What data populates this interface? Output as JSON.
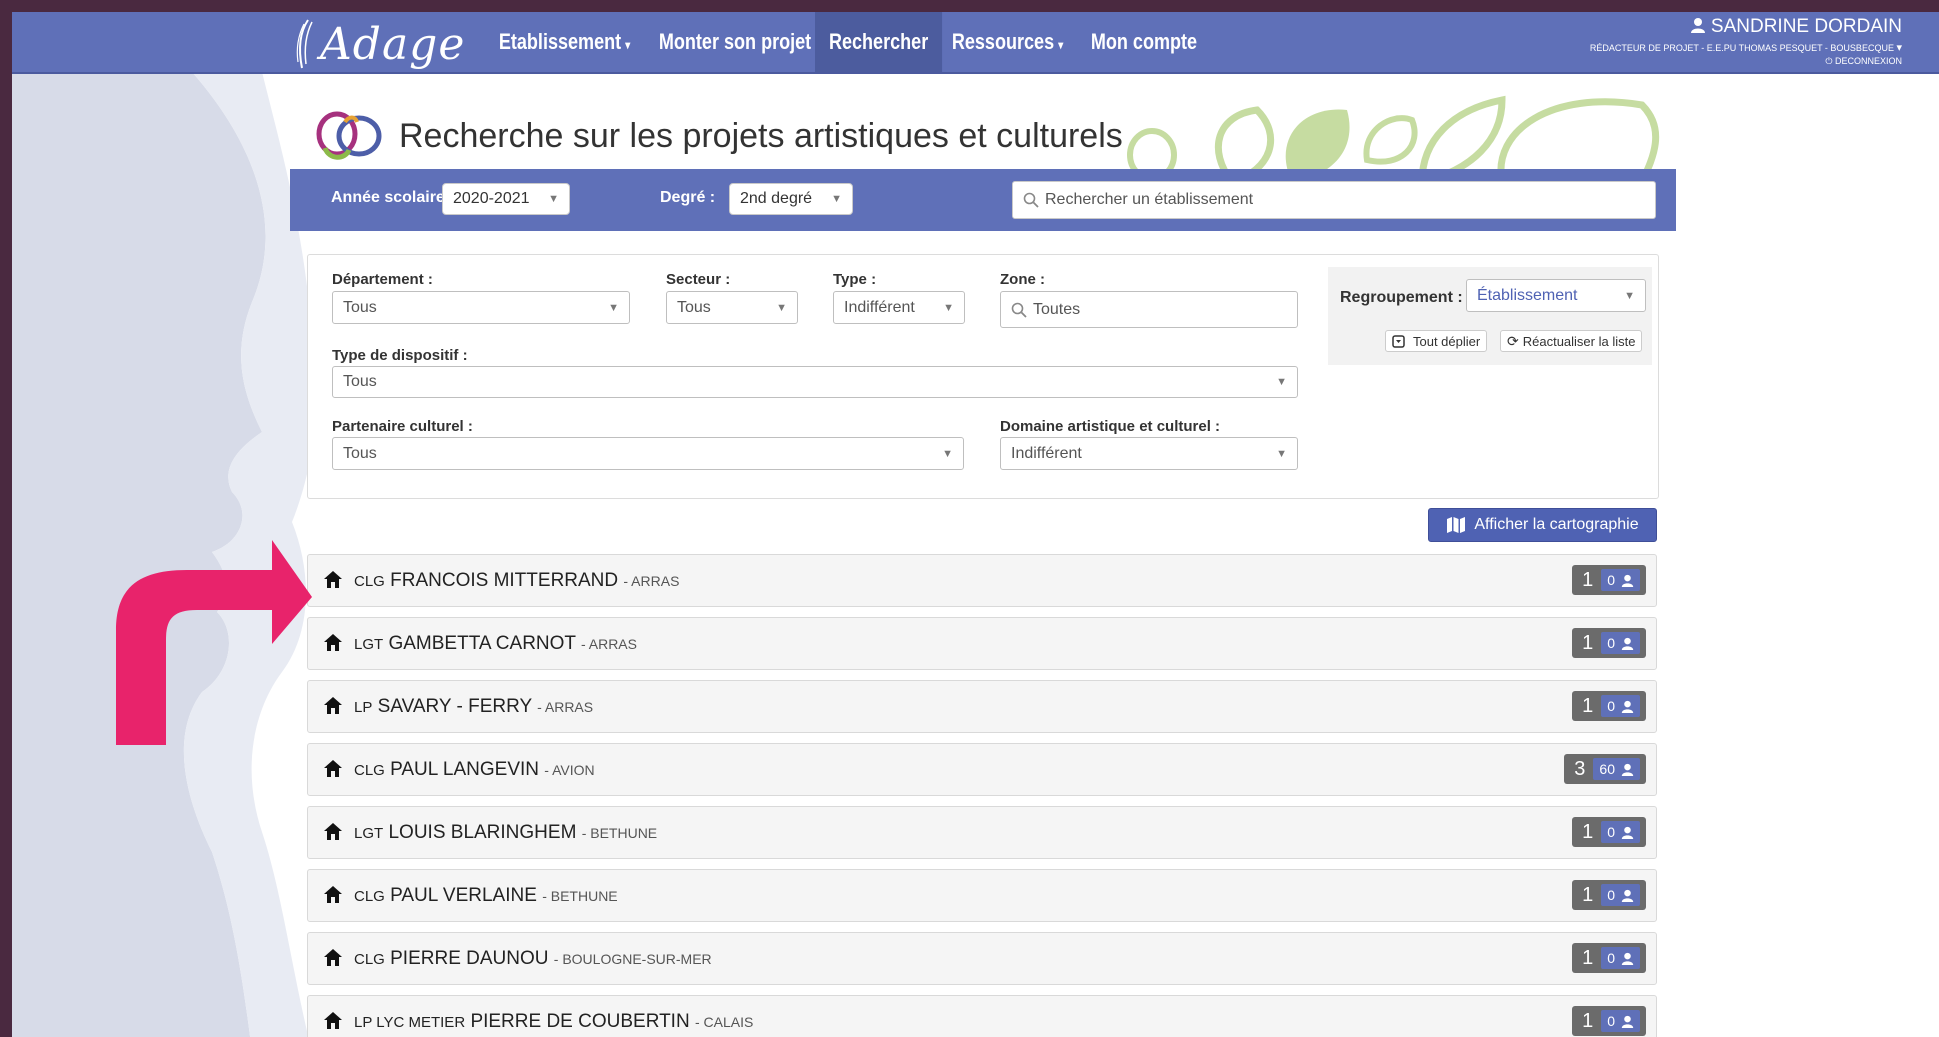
{
  "app": {
    "logo_text": "Adage"
  },
  "nav": {
    "items": [
      {
        "label": "Etablissement",
        "has_dropdown": true
      },
      {
        "label": "Monter son projet",
        "has_dropdown": false
      },
      {
        "label": "Rechercher",
        "has_dropdown": false,
        "active": true
      },
      {
        "label": "Ressources",
        "has_dropdown": true
      },
      {
        "label": "Mon compte",
        "has_dropdown": false
      }
    ],
    "caret": "▾"
  },
  "user": {
    "name": "SANDRINE DORDAIN",
    "role": "RÉDACTEUR DE PROJET - E.E.PU THOMAS PESQUET - BOUSBECQUE",
    "logout": "DECONNEXION"
  },
  "page": {
    "title": "Recherche sur les projets artistiques et culturels"
  },
  "search": {
    "year_label": "Année scolaire :",
    "year_value": "2020-2021",
    "degree_label": "Degré :",
    "degree_value": "2nd degré",
    "placeholder": "Rechercher un établissement"
  },
  "filters": {
    "departement": {
      "label": "Département :",
      "value": "Tous"
    },
    "secteur": {
      "label": "Secteur :",
      "value": "Tous"
    },
    "type": {
      "label": "Type :",
      "value": "Indifférent"
    },
    "zone": {
      "label": "Zone :",
      "value": "Toutes"
    },
    "dispositif": {
      "label": "Type de dispositif :",
      "value": "Tous"
    },
    "partenaire": {
      "label": "Partenaire culturel :",
      "value": "Tous"
    },
    "domaine": {
      "label": "Domaine artistique et culturel :",
      "value": "Indifférent"
    },
    "regroupement": {
      "label": "Regroupement :",
      "value": "Établissement"
    },
    "expand_all": "Tout déplier",
    "refresh": "Réactualiser la liste"
  },
  "map_button": "Afficher la cartographie",
  "results": [
    {
      "type": "CLG",
      "name": "FRANCOIS MITTERRAND",
      "city": "- ARRAS",
      "count": "1",
      "persons": "0"
    },
    {
      "type": "LGT",
      "name": "GAMBETTA CARNOT",
      "city": "- ARRAS",
      "count": "1",
      "persons": "0"
    },
    {
      "type": "LP",
      "name": "SAVARY - FERRY",
      "city": "- ARRAS",
      "count": "1",
      "persons": "0"
    },
    {
      "type": "CLG",
      "name": "PAUL LANGEVIN",
      "city": "- AVION",
      "count": "3",
      "persons": "60"
    },
    {
      "type": "LGT",
      "name": "LOUIS BLARINGHEM",
      "city": "- BETHUNE",
      "count": "1",
      "persons": "0"
    },
    {
      "type": "CLG",
      "name": "PAUL VERLAINE",
      "city": "- BETHUNE",
      "count": "1",
      "persons": "0"
    },
    {
      "type": "CLG",
      "name": "PIERRE DAUNOU",
      "city": "- BOULOGNE-SUR-MER",
      "count": "1",
      "persons": "0"
    },
    {
      "type": "LP LYC METIER",
      "name": "PIERRE DE COUBERTIN",
      "city": "- CALAIS",
      "count": "1",
      "persons": "0"
    }
  ],
  "colors": {
    "primary": "#5f70b8",
    "annotation_arrow": "#e8236b"
  }
}
